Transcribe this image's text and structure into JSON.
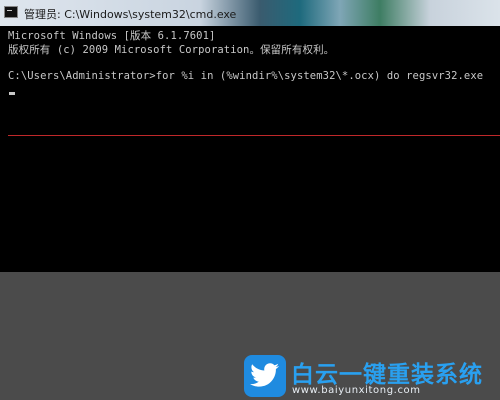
{
  "window": {
    "title": "管理员: C:\\Windows\\system32\\cmd.exe",
    "icon": "cmd-icon"
  },
  "console": {
    "lines": [
      "Microsoft Windows [版本 6.1.7601]",
      "版权所有 (c) 2009 Microsoft Corporation。保留所有权利。",
      "",
      "C:\\Users\\Administrator>for %i in (%windir%\\system32\\*.ocx) do regsvr32.exe"
    ]
  },
  "watermark": {
    "name_cn": "白云一键重装系统",
    "url": "www.baiyunxitong.com",
    "icon": "twitter-bird-icon",
    "brand_color": "#29a0f0"
  }
}
